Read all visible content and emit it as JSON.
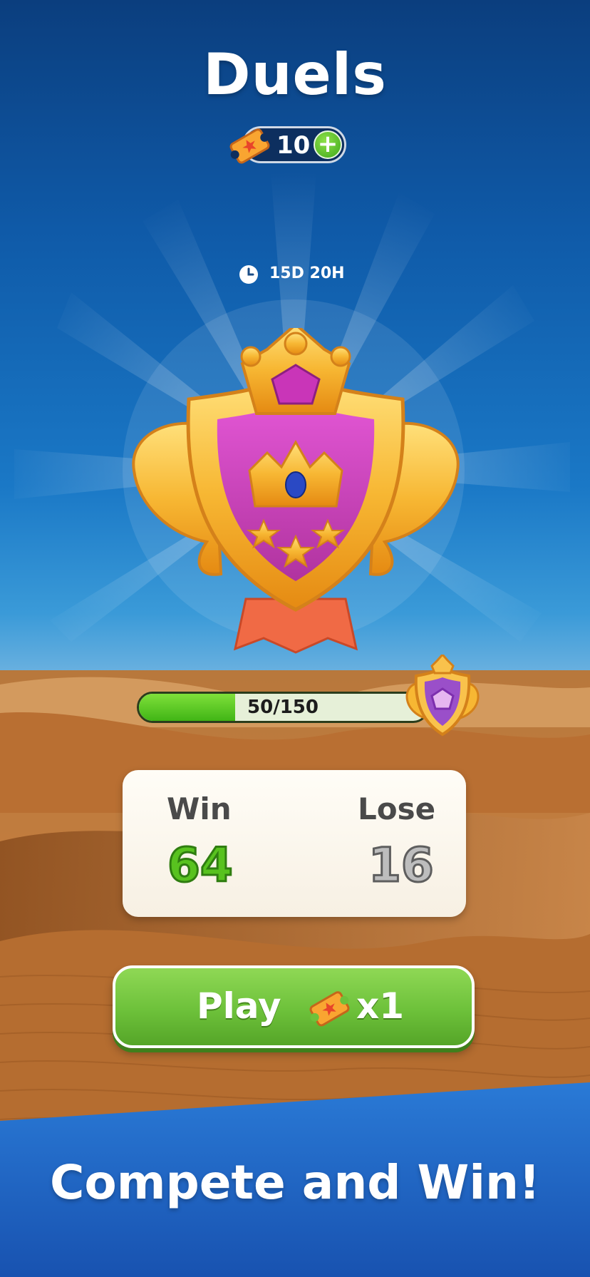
{
  "header": {
    "title": "Duels"
  },
  "tickets": {
    "count": "10",
    "add_icon": "plus-icon",
    "ticket_icon": "ticket-icon"
  },
  "timer": {
    "icon": "clock-icon",
    "label": "15D 20H"
  },
  "badge": {
    "icon": "crown-shield-badge"
  },
  "progress": {
    "label_current": "50",
    "label_sep": "/",
    "label_total": "150",
    "value": 50,
    "max": 150
  },
  "stats": {
    "win_label": "Win",
    "win_value": "64",
    "lose_label": "Lose",
    "lose_value": "16"
  },
  "play_button": {
    "label": "Play",
    "cost": "x1"
  },
  "footer": {
    "tagline": "Compete and Win!"
  },
  "colors": {
    "sky_top": "#0b3e7e",
    "sky_bottom": "#9bc6e4",
    "sand": "#c27a34",
    "button_green": "#6dc13a",
    "banner_blue": "#1f63c4",
    "badge_gold": "#f7b733",
    "badge_purple": "#c23fb5"
  }
}
